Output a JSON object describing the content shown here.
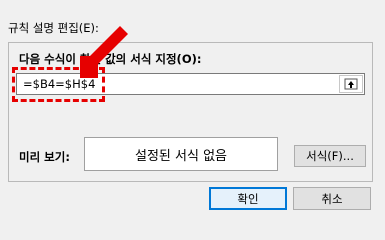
{
  "rule_edit": {
    "section_title": "규칙 설명 편집(E):",
    "formula_label": "다음 수식이 참인 값의 서식 지정(O):",
    "formula_value": "=$B4=$H$4",
    "preview_label": "미리 보기:",
    "preview_text": "설정된 서식 없음",
    "format_button": "서식(F)..."
  },
  "dialog_buttons": {
    "ok": "확인",
    "cancel": "취소"
  },
  "colors": {
    "annotation": "#e60000",
    "ok_border": "#0078d7"
  },
  "icons": {
    "collapse": "collapse-dialog-icon",
    "annotation_arrow": "arrow-annotation"
  }
}
